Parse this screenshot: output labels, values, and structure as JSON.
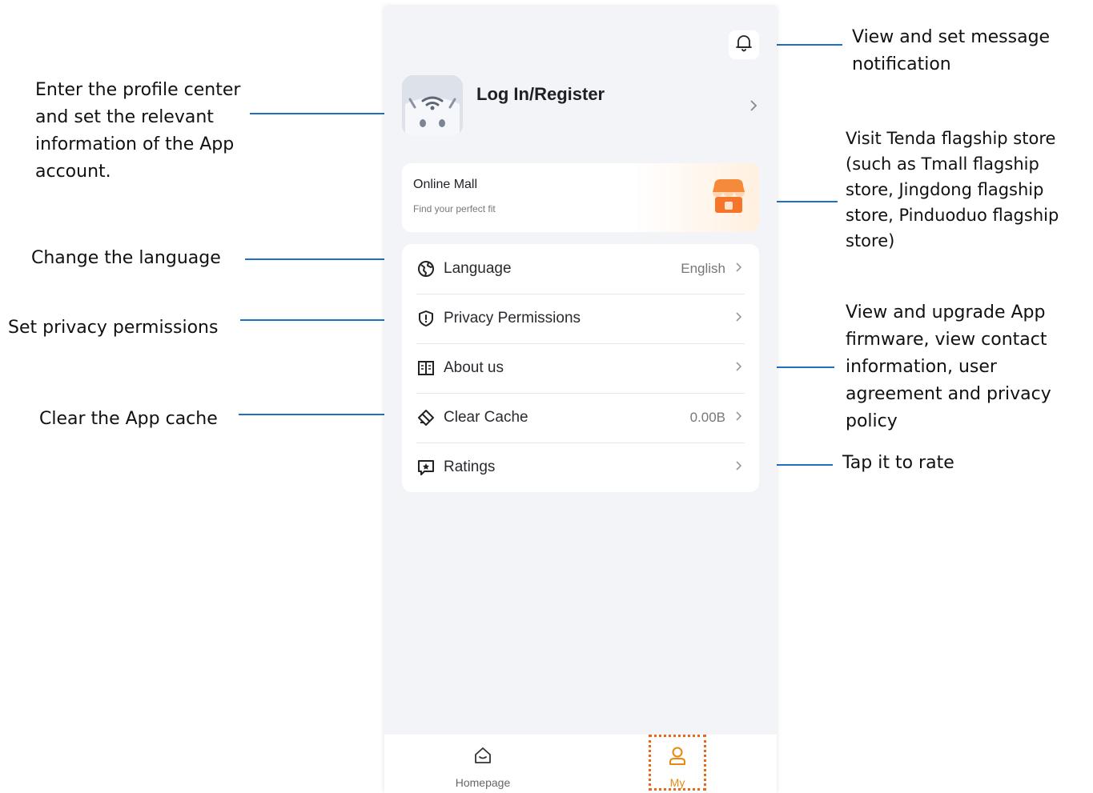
{
  "annotations": {
    "notification": "View and set message\nnotification",
    "profile": "Enter the profile center\nand set the relevant\ninformation of the App\naccount.",
    "store": "Visit Tenda flagship store\n(such as Tmall flagship\nstore, Jingdong flagship\nstore, Pinduoduo flagship\nstore)",
    "language": "Change the language",
    "privacy": "Set privacy permissions",
    "about": "View and upgrade App\nfirmware, view contact\ninformation, user\nagreement and privacy\npolicy",
    "cache": "Clear the App cache",
    "rate": "Tap it to rate"
  },
  "profile": {
    "login_label": "Log In/Register"
  },
  "mall": {
    "title": "Online Mall",
    "subtitle": "Find your perfect fit"
  },
  "menu": {
    "language": {
      "label": "Language",
      "value": "English",
      "icon": "globe-icon"
    },
    "privacy": {
      "label": "Privacy Permissions",
      "icon": "shield-icon"
    },
    "about": {
      "label": "About us",
      "icon": "book-icon"
    },
    "cache": {
      "label": "Clear Cache",
      "value": "0.00B",
      "icon": "eraser-icon"
    },
    "ratings": {
      "label": "Ratings",
      "icon": "star-message-icon"
    }
  },
  "tabs": [
    {
      "label": "Homepage",
      "icon": "home-icon",
      "color": "#666666"
    },
    {
      "label": "My",
      "icon": "user-icon",
      "color": "#e8890f"
    }
  ],
  "colors": {
    "accent": "#e8890f",
    "callout_line": "#1f6fc4",
    "highlight_box": "#e8671a"
  }
}
